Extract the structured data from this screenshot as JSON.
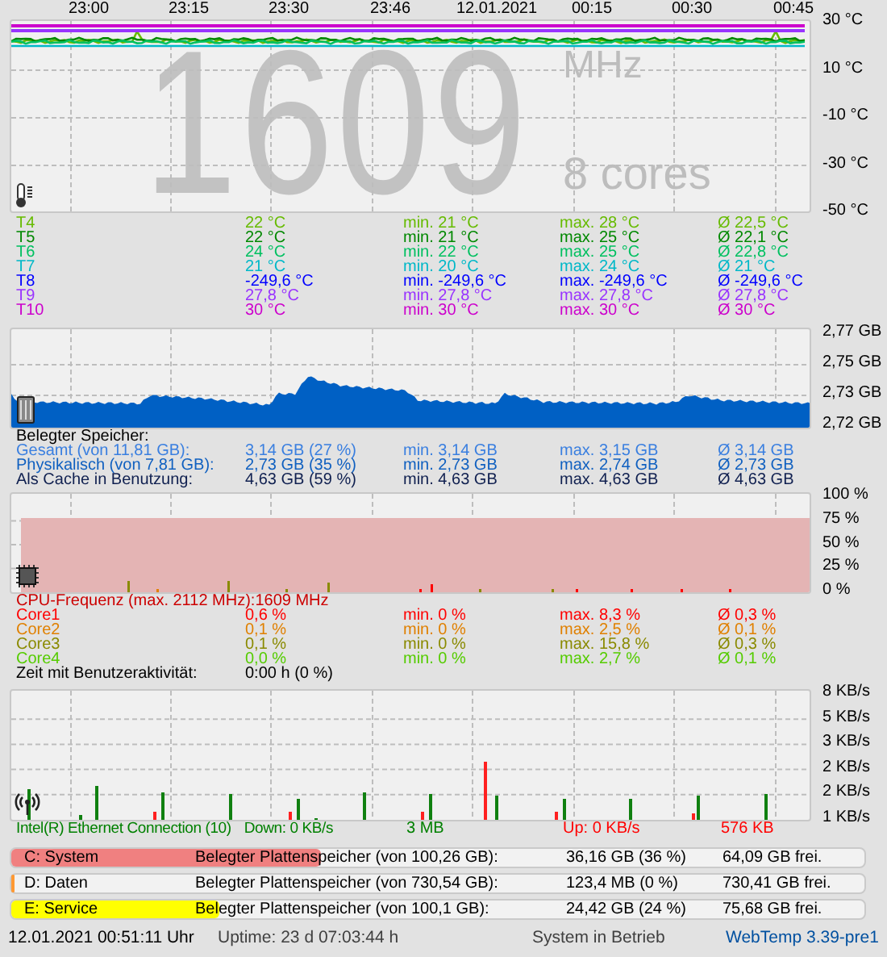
{
  "temp_graph": {
    "time_labels": [
      "23:00",
      "23:15",
      "23:30",
      "23:46",
      "12.01.2021",
      "00:15",
      "00:30",
      "00:45"
    ],
    "y_labels": [
      "30 °C",
      "10 °C",
      "-10 °C",
      "-30 °C",
      "-50 °C"
    ],
    "frequency": "1609",
    "unit": "MHz",
    "cores": "8 cores"
  },
  "sensors": [
    {
      "name": "T4",
      "current": "22 °C",
      "min": "min. 21 °C",
      "max": "max. 28 °C",
      "avg": "Ø 22,5 °C",
      "color": "#66bb00"
    },
    {
      "name": "T5",
      "current": "22 °C",
      "min": "min. 21 °C",
      "max": "max. 25 °C",
      "avg": "Ø 22,1 °C",
      "color": "#008800"
    },
    {
      "name": "T6",
      "current": "24 °C",
      "min": "min. 22 °C",
      "max": "max. 25 °C",
      "avg": "Ø 22,8 °C",
      "color": "#00c060"
    },
    {
      "name": "T7",
      "current": "21 °C",
      "min": "min. 20 °C",
      "max": "max. 24 °C",
      "avg": "Ø 21 °C",
      "color": "#00b8c8"
    },
    {
      "name": "T8",
      "current": "-249,6 °C",
      "min": "min. -249,6 °C",
      "max": "max. -249,6 °C",
      "avg": "Ø -249,6 °C",
      "color": "#0000ff"
    },
    {
      "name": "T9",
      "current": "27,8 °C",
      "min": "min. 27,8 °C",
      "max": "max. 27,8 °C",
      "avg": "Ø 27,8 °C",
      "color": "#9933ff"
    },
    {
      "name": "T10",
      "current": "30 °C",
      "min": "min. 30 °C",
      "max": "max. 30 °C",
      "avg": "Ø 30 °C",
      "color": "#cc00cc"
    }
  ],
  "memory_graph": {
    "y_labels": [
      "2,77 GB",
      "2,75 GB",
      "2,73 GB",
      "2,72 GB"
    ]
  },
  "memory": {
    "heading": "Belegter Speicher:",
    "rows": [
      {
        "label": "Gesamt (von 11,81 GB):",
        "current": "3,14 GB (27 %)",
        "min": "min. 3,14 GB",
        "max": "max. 3,15 GB",
        "avg": "Ø 3,14 GB",
        "color": "#3a7fe0"
      },
      {
        "label": "Physikalisch (von 7,81 GB):",
        "current": "2,73 GB (35 %)",
        "min": "min. 2,73 GB",
        "max": "max. 2,74 GB",
        "avg": "Ø 2,73 GB",
        "color": "#1060c0"
      },
      {
        "label": "Als Cache in Benutzung:",
        "current": "4,63 GB (59 %)",
        "min": "min. 4,63 GB",
        "max": "max. 4,63 GB",
        "avg": "Ø 4,63 GB",
        "color": "#102050"
      }
    ]
  },
  "cpu_graph": {
    "y_labels": [
      "100 %",
      "75 %",
      "50 %",
      "25 %",
      "0 %"
    ]
  },
  "cpu": {
    "frequency_label": "CPU-Frequenz (max. 2112 MHz):",
    "frequency": "1609 MHz",
    "cores": [
      {
        "name": "Core1",
        "current": "0,6 %",
        "min": "min. 0 %",
        "max": "max. 8,3 %",
        "avg": "Ø 0,3 %",
        "color": "#ff0000"
      },
      {
        "name": "Core2",
        "current": "0,1 %",
        "min": "min. 0 %",
        "max": "max. 2,5 %",
        "avg": "Ø 0,1 %",
        "color": "#e08000"
      },
      {
        "name": "Core3",
        "current": "0,1 %",
        "min": "min. 0 %",
        "max": "max. 15,8 %",
        "avg": "Ø 0,3 %",
        "color": "#8a8a00"
      },
      {
        "name": "Core4",
        "current": "0,0 %",
        "min": "min. 0 %",
        "max": "max. 2,7 %",
        "avg": "Ø 0,1 %",
        "color": "#55cc00"
      }
    ],
    "activity_label": "Zeit mit Benutzeraktivität:",
    "activity": "0:00 h (0 %)"
  },
  "network_graph": {
    "y_labels": [
      "8 KB/s",
      "5 KB/s",
      "3 KB/s",
      "2 KB/s",
      "2 KB/s",
      "1 KB/s"
    ]
  },
  "network": {
    "adapter": "Intel(R) Ethernet Connection (10)",
    "down": "Down: 0 KB/s",
    "down_total": "3 MB",
    "up": "Up: 0 KB/s",
    "up_total": "576 KB"
  },
  "drives": [
    {
      "name": "C: System",
      "label": "Belegter Plattenspeicher (von 100,26 GB):",
      "used": "36,16 GB (36 %)",
      "free": "64,09 GB frei.",
      "level": 0.36,
      "color": "#f08080"
    },
    {
      "name": "D: Daten",
      "label": "Belegter Plattenspeicher (von 730,54 GB):",
      "used": "123,4 MB (0 %)",
      "free": "730,41 GB frei.",
      "level": 0,
      "color": "#ff9933"
    },
    {
      "name": "E: Service",
      "label": "Belegter Plattenspeicher (von 100,1 GB):",
      "used": "24,42 GB (24 %)",
      "free": "75,68 GB frei.",
      "level": 0.24,
      "color": "#ffff00"
    }
  ],
  "status_bar": {
    "datetime": "12.01.2021 00:51:11 Uhr",
    "uptime": "Uptime: 23 d 07:03:44 h",
    "state": "System in Betrieb",
    "version": "WebTemp 3.39-pre1"
  }
}
